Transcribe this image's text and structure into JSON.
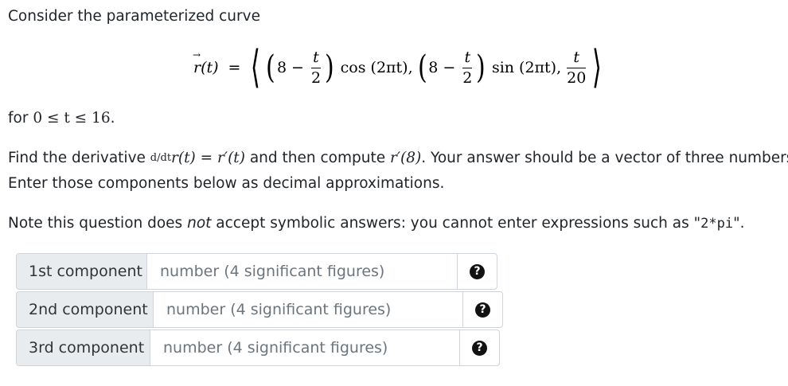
{
  "intro": "Consider the parameterized curve",
  "equation": {
    "lhs": "r(t)",
    "eq": "=",
    "term1_const": "8",
    "minus": "−",
    "t": "t",
    "two": "2",
    "cos_arg": "cos (2πt),",
    "sin_arg": "sin (2πt),",
    "twenty": "20"
  },
  "domain": {
    "prefix": "for",
    "expr": "0 ≤ t ≤ 16",
    "suffix": "."
  },
  "instructions": {
    "line1_a": "Find the derivative",
    "deriv_op": "d/dt",
    "line1_expr": "r(t) = r′(t)",
    "line1_b": "and then compute",
    "line1_eval": "r′(8)",
    "line1_c": ". Your answer should be a vector of three numbers.",
    "line2": "Enter those components below as decimal approximations."
  },
  "note": {
    "a": "Note this question does",
    "em": "not",
    "b": "accept symbolic answers: you cannot enter expressions such as \"",
    "code": "2*pi",
    "c": "\"."
  },
  "inputs": [
    {
      "label": "1st component",
      "placeholder": "number (4 significant figures)",
      "value": ""
    },
    {
      "label": "2nd component",
      "placeholder": "number (4 significant figures)",
      "value": ""
    },
    {
      "label": "3rd component",
      "placeholder": "number (4 significant figures)",
      "value": ""
    }
  ],
  "help_icon": "question-circle-icon",
  "help_glyph": "?"
}
